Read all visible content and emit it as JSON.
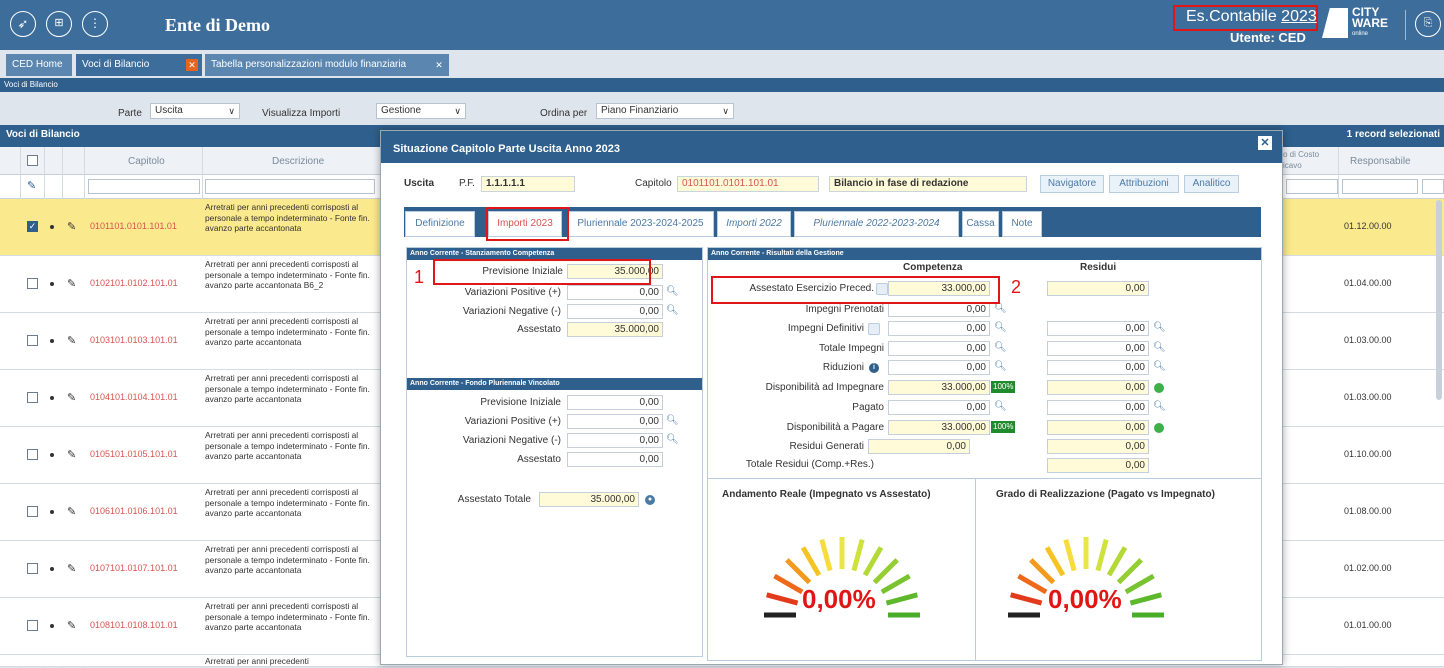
{
  "app": {
    "title": "Ente di Demo",
    "year_label": "Es.Contabile",
    "year": "2023",
    "user": "Utente: CED",
    "logo_top": "CITY",
    "logo_bottom": "WARE",
    "logo_small": "online"
  },
  "tabs": [
    {
      "label": "CED Home"
    },
    {
      "label": "Voci di Bilancio"
    },
    {
      "label": "Tabella personalizzazioni modulo finanziaria"
    }
  ],
  "breadcrumb": "Voci di Bilancio",
  "filters": {
    "parte_label": "Parte",
    "parte_value": "Uscita",
    "importi_label": "Visualizza Importi",
    "importi_value": "Gestione",
    "ordina_label": "Ordina per",
    "ordina_value": "Piano Finanziario"
  },
  "grid": {
    "title": "Voci di Bilancio",
    "selected_count": "1 record selezionati",
    "col_capitolo": "Capitolo",
    "col_descrizione": "Descrizione",
    "col_costo": "o di Costo",
    "col_costo2": "icavo",
    "col_responsabile": "Responsabile",
    "rows": [
      {
        "capitolo": "0101101.0101.101.01",
        "descrizione": "Arretrati per anni precedenti corrisposti al personale a tempo indeterminato - Fonte fin. avanzo parte accantonata",
        "responsabile": "01.12.00.00"
      },
      {
        "capitolo": "0102101.0102.101.01",
        "descrizione": "Arretrati per anni precedenti corrisposti al personale a tempo indeterminato - Fonte fin. avanzo parte accantonata B6_2",
        "responsabile": "01.04.00.00"
      },
      {
        "capitolo": "0103101.0103.101.01",
        "descrizione": "Arretrati per anni precedenti corrisposti al personale a tempo indeterminato - Fonte fin. avanzo parte accantonata",
        "responsabile": "01.03.00.00"
      },
      {
        "capitolo": "0104101.0104.101.01",
        "descrizione": "Arretrati per anni precedenti corrisposti al personale a tempo indeterminato - Fonte fin. avanzo parte accantonata",
        "responsabile": "01.03.00.00"
      },
      {
        "capitolo": "0105101.0105.101.01",
        "descrizione": "Arretrati per anni precedenti corrisposti al personale a tempo indeterminato - Fonte fin. avanzo parte accantonata",
        "responsabile": "01.10.00.00"
      },
      {
        "capitolo": "0106101.0106.101.01",
        "descrizione": "Arretrati per anni precedenti corrisposti al personale a tempo indeterminato - Fonte fin. avanzo parte accantonata",
        "responsabile": "01.08.00.00"
      },
      {
        "capitolo": "0107101.0107.101.01",
        "descrizione": "Arretrati per anni precedenti corrisposti al personale a tempo indeterminato - Fonte fin. avanzo parte accantonata",
        "responsabile": "01.02.00.00"
      },
      {
        "capitolo": "0108101.0108.101.01",
        "descrizione": "Arretrati per anni precedenti corrisposti al personale a tempo indeterminato - Fonte fin. avanzo parte accantonata",
        "responsabile": "01.01.00.00"
      },
      {
        "capitolo": "",
        "descrizione": "Arretrati per anni precedenti",
        "responsabile": ""
      }
    ]
  },
  "modal": {
    "title": "Situazione Capitolo Parte Uscita Anno 2023",
    "tipo": "Uscita",
    "pf_label": "P.F.",
    "pf_value": "1.1.1.1.1",
    "capitolo_label": "Capitolo",
    "capitolo_value": "0101101.0101.101.01",
    "stato": "Bilancio in fase di redazione",
    "buttons": {
      "navigatore": "Navigatore",
      "attribuzioni": "Attribuzioni",
      "analitico": "Analitico"
    },
    "tabs": [
      "Definizione",
      "Importi 2023",
      "Pluriennale 2023-2024-2025",
      "Importi 2022",
      "Pluriennale 2022-2023-2024",
      "Cassa",
      "Note"
    ],
    "stanz": {
      "title": "Anno Corrente - Stanziamento Competenza",
      "previsione_label": "Previsione Iniziale",
      "previsione": "35.000,00",
      "var_pos_label": "Variazioni Positive (+)",
      "var_pos": "0,00",
      "var_neg_label": "Variazioni Negative (-)",
      "var_neg": "0,00",
      "assestato_label": "Assestato",
      "assestato": "35.000,00"
    },
    "fondo": {
      "title": "Anno Corrente - Fondo Pluriennale Vincolato",
      "previsione_label": "Previsione Iniziale",
      "previsione": "0,00",
      "var_pos_label": "Variazioni Positive (+)",
      "var_pos": "0,00",
      "var_neg_label": "Variazioni Negative (-)",
      "var_neg": "0,00",
      "assestato_label": "Assestato",
      "assestato": "0,00"
    },
    "assestato_totale_label": "Assestato Totale",
    "assestato_totale": "35.000,00",
    "risultati": {
      "title": "Anno Corrente - Risultati della Gestione",
      "col_comp": "Competenza",
      "col_res": "Residui",
      "assestato_prec_label": "Assestato Esercizio Preced.",
      "assestato_prec_comp": "33.000,00",
      "assestato_prec_res": "0,00",
      "imp_pren_label": "Impegni Prenotati",
      "imp_pren_comp": "0,00",
      "imp_def_label": "Impegni Definitivi",
      "imp_def_comp": "0,00",
      "imp_def_res": "0,00",
      "tot_imp_label": "Totale Impegni",
      "tot_imp_comp": "0,00",
      "tot_imp_res": "0,00",
      "riduzioni_label": "Riduzioni",
      "riduzioni_comp": "0,00",
      "riduzioni_res": "0,00",
      "disp_imp_label": "Disponibilità ad Impegnare",
      "disp_imp_comp": "33.000,00",
      "disp_imp_pct": "100%",
      "disp_imp_res": "0,00",
      "pagato_label": "Pagato",
      "pagato_comp": "0,00",
      "pagato_res": "0,00",
      "disp_pag_label": "Disponibilità a Pagare",
      "disp_pag_comp": "33.000,00",
      "disp_pag_pct": "100%",
      "disp_pag_res": "0,00",
      "res_gen_label": "Residui Generati",
      "res_gen_comp": "0,00",
      "res_gen_res": "0,00",
      "tot_res_label": "Totale Residui (Comp.+Res.)",
      "tot_res_res": "0,00"
    },
    "gauges": [
      {
        "title": "Andamento Reale (Impegnato vs Assestato)",
        "value": "0,00%"
      },
      {
        "title": "Grado di Realizzazione (Pagato vs Impegnato)",
        "value": "0,00%"
      }
    ]
  },
  "annotations": {
    "n1": "1",
    "n2": "2"
  }
}
